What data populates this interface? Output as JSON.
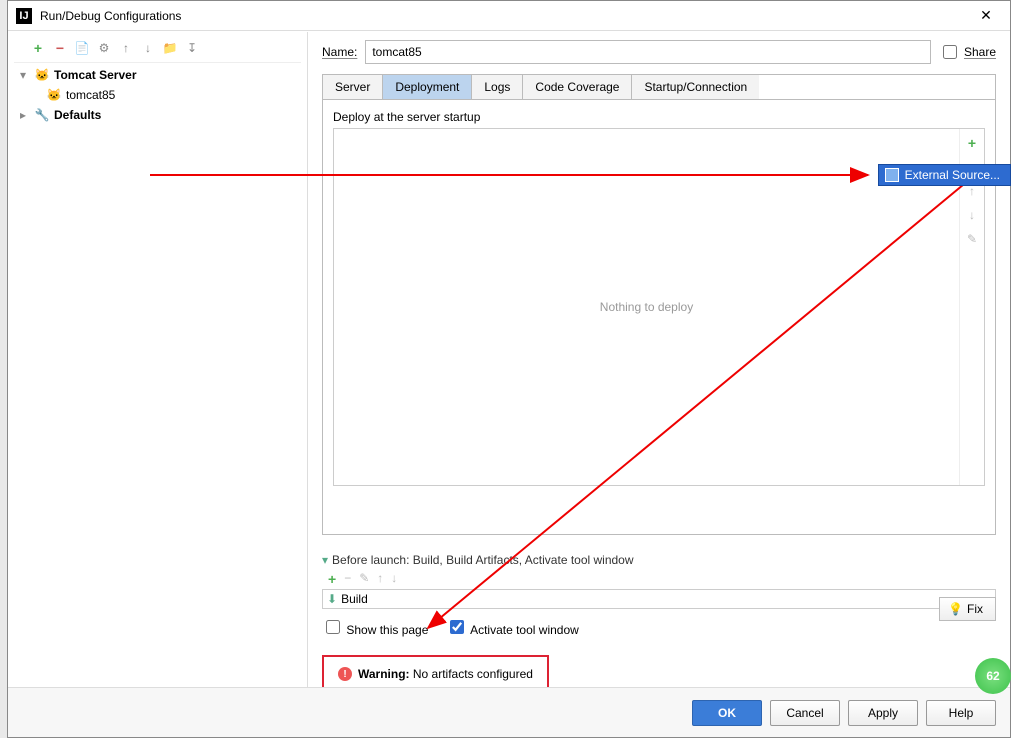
{
  "titlebar": {
    "title": "Run/Debug Configurations"
  },
  "tree": {
    "node1": "Tomcat Server",
    "node1_child": "tomcat85",
    "node2": "Defaults"
  },
  "form": {
    "name_label": "Name:",
    "name_value": "tomcat85",
    "share_label": "Share"
  },
  "tabs": {
    "t0": "Server",
    "t1": "Deployment",
    "t2": "Logs",
    "t3": "Code Coverage",
    "t4": "Startup/Connection"
  },
  "deployment": {
    "label": "Deploy at the server startup",
    "empty": "Nothing to deploy"
  },
  "popup": {
    "label": "External Source..."
  },
  "before_launch": {
    "title": "Before launch: Build, Build Artifacts, Activate tool window",
    "item0": "Build",
    "show_this_page": "Show this page",
    "activate": "Activate tool window"
  },
  "warning": {
    "label": "Warning:",
    "text": " No artifacts configured"
  },
  "fix": "Fix",
  "footer": {
    "ok": "OK",
    "cancel": "Cancel",
    "apply": "Apply",
    "help": "Help"
  },
  "bubble": "62"
}
